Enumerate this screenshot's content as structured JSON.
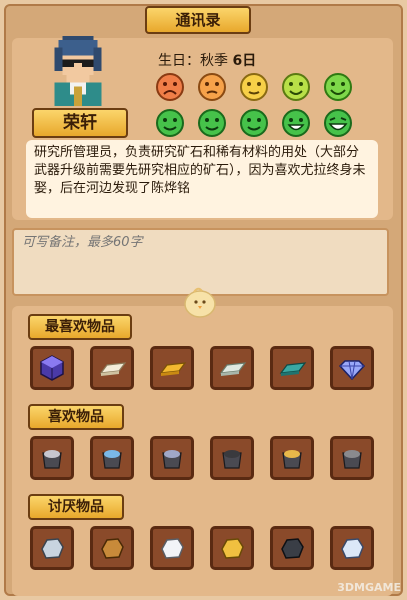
{
  "window_title": "通讯录",
  "npc": {
    "name": "荣轩",
    "birthday_label": "生日：秋季",
    "birthday_day": "6日",
    "description": "研究所管理员，负责研究矿石和稀有材料的用处（大部分武器升级前需要先研究相应的矿石），因为喜欢尤拉终身未娶，后在河边发现了陈烨铭"
  },
  "note": {
    "placeholder": "可写备注，最多60字"
  },
  "favor_faces": {
    "row1": [
      "very-sad-face-icon",
      "sad-face-icon",
      "neutral-face-icon",
      "smile-face-icon",
      "happy-face-icon"
    ],
    "row2": [
      "green-smile-face-icon",
      "green-smile-face-icon",
      "green-smile-face-icon",
      "green-grin-face-icon",
      "green-laugh-face-icon"
    ]
  },
  "sections": {
    "loved": {
      "label": "最喜欢物品",
      "items": [
        "purple-cube-icon",
        "white-ingot-icon",
        "gold-ingot-icon",
        "silver-ingot-icon",
        "teal-ingot-icon",
        "diamond-icon"
      ]
    },
    "liked": {
      "label": "喜欢物品",
      "items": [
        "silver-ore-icon",
        "blue-ore-icon",
        "blue-gray-ore-icon",
        "dark-ore-icon",
        "gold-ore-icon",
        "gray-ore-icon"
      ]
    },
    "disliked": {
      "label": "讨厌物品",
      "items": [
        "pale-stone-icon",
        "copper-stone-icon",
        "white-stone-icon",
        "gold-stone-icon",
        "dark-stone-icon",
        "blue-white-stone-icon"
      ]
    }
  },
  "watermark": "3DMGAME",
  "colors": {
    "button_gold": "#f3be48",
    "panel": "#e3b88a",
    "slot": "#8a4a2a"
  }
}
